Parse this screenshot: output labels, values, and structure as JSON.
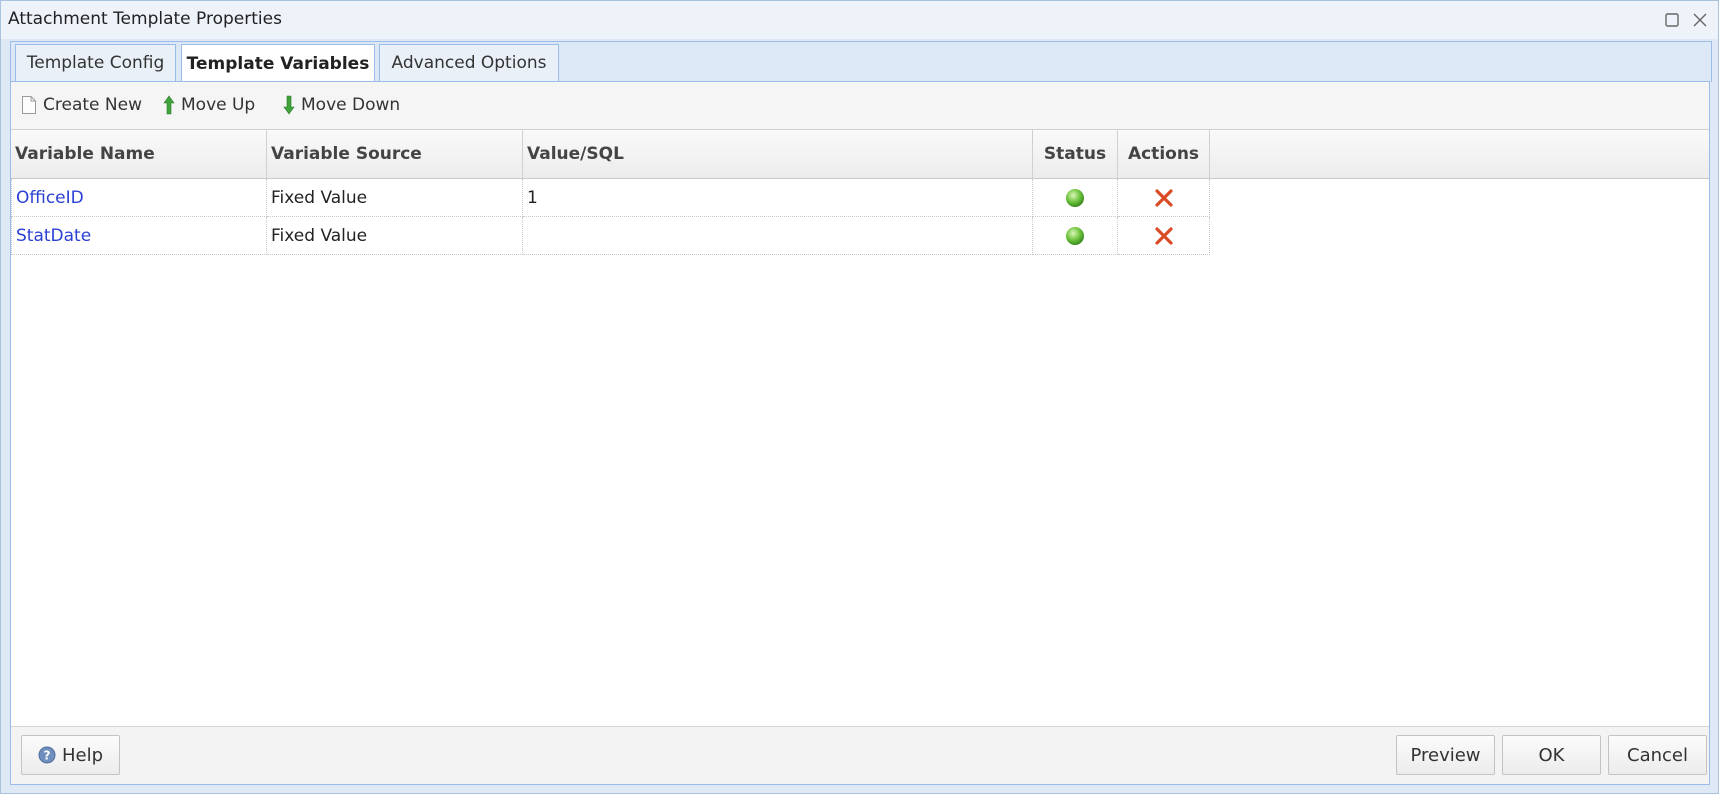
{
  "window": {
    "title": "Attachment Template Properties"
  },
  "tabs": [
    {
      "label": "Template Config",
      "active": false
    },
    {
      "label": "Template Variables",
      "active": true
    },
    {
      "label": "Advanced Options",
      "active": false
    }
  ],
  "toolbar": {
    "create_new": "Create New",
    "move_up": "Move Up",
    "move_down": "Move Down"
  },
  "grid": {
    "columns": [
      "Variable Name",
      "Variable Source",
      "Value/SQL",
      "Status",
      "Actions"
    ],
    "rows": [
      {
        "name": "OfficeID",
        "source": "Fixed Value",
        "value": "1",
        "status": "ok",
        "action": "delete"
      },
      {
        "name": "StatDate",
        "source": "Fixed Value",
        "value": "",
        "status": "ok",
        "action": "delete"
      }
    ]
  },
  "footer": {
    "help": "Help",
    "preview": "Preview",
    "ok": "OK",
    "cancel": "Cancel"
  },
  "colors": {
    "link": "#2a3fd4",
    "status_ok": "#5bb52f",
    "delete": "#d94b25",
    "arrow": "#3fa33a",
    "border": "#99bce8"
  },
  "icons": {
    "maximize": "maximize-icon",
    "close": "close-icon",
    "create_new": "document-icon",
    "move_up": "arrow-up-icon",
    "move_down": "arrow-down-icon",
    "status": "green-status-dot-icon",
    "delete": "red-x-delete-icon",
    "help": "help-question-icon"
  }
}
